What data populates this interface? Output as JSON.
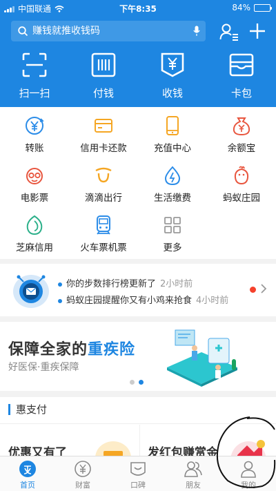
{
  "status": {
    "carrier": "中国联通",
    "time": "下午8:35",
    "battery": "84%",
    "battery_level": 0.84
  },
  "search": {
    "placeholder": "赚钱就推收钱码"
  },
  "top_actions": [
    {
      "label": "扫一扫",
      "icon": "scan-icon"
    },
    {
      "label": "付钱",
      "icon": "barcode-icon"
    },
    {
      "label": "收钱",
      "icon": "yuan-receipt-icon"
    },
    {
      "label": "卡包",
      "icon": "card-wallet-icon"
    }
  ],
  "grid": [
    {
      "label": "转账",
      "icon": "transfer-icon",
      "color": "#2b8ce8"
    },
    {
      "label": "信用卡还款",
      "icon": "credit-card-icon",
      "color": "#f5a623"
    },
    {
      "label": "充值中心",
      "icon": "phone-recharge-icon",
      "color": "#f5a623"
    },
    {
      "label": "余额宝",
      "icon": "money-bag-icon",
      "color": "#e8553e"
    },
    {
      "label": "电影票",
      "icon": "movie-ticket-icon",
      "color": "#e8553e"
    },
    {
      "label": "滴滴出行",
      "icon": "didi-icon",
      "color": "#f5a623"
    },
    {
      "label": "生活缴费",
      "icon": "utility-drop-icon",
      "color": "#2b8ce8"
    },
    {
      "label": "蚂蚁庄园",
      "icon": "chicken-icon",
      "color": "#e8553e"
    },
    {
      "label": "芝麻信用",
      "icon": "sesame-credit-icon",
      "color": "#2cb08a"
    },
    {
      "label": "火车票机票",
      "icon": "train-icon",
      "color": "#2b8ce8"
    },
    {
      "label": "更多",
      "icon": "more-grid-icon",
      "color": "#999999"
    }
  ],
  "notices": [
    {
      "text": "你的步数排行榜更新了",
      "time": "2小时前"
    },
    {
      "text": "蚂蚁庄园提醒你又有小鸡来抢食",
      "time": "4小时前"
    }
  ],
  "banner": {
    "title_prefix": "保障全家的",
    "title_highlight": "重疾险",
    "subtitle": "好医保·重疾保障"
  },
  "section": {
    "title": "惠支付",
    "card_left": "优惠又有了",
    "card_right": "发红包赚赏金"
  },
  "tabs": [
    {
      "label": "首页",
      "icon": "home-icon",
      "active": true
    },
    {
      "label": "财富",
      "icon": "wealth-icon",
      "active": false
    },
    {
      "label": "口碑",
      "icon": "koubei-icon",
      "active": false
    },
    {
      "label": "朋友",
      "icon": "friends-icon",
      "active": false
    },
    {
      "label": "我的",
      "icon": "profile-icon",
      "active": false
    }
  ],
  "colors": {
    "brand": "#1e86e1",
    "notice_dot": "#f5412c"
  }
}
